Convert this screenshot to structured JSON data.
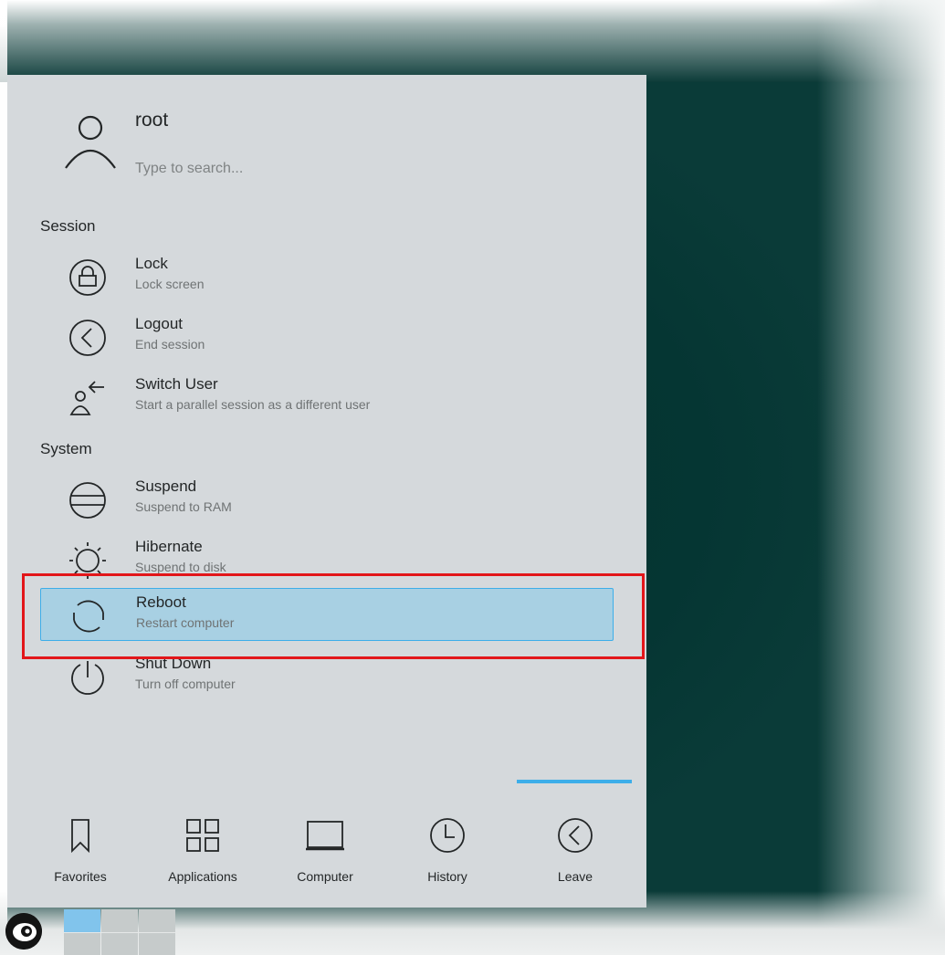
{
  "user": {
    "name": "root",
    "search_placeholder": "Type to search..."
  },
  "sections": {
    "session": "Session",
    "system": "System"
  },
  "session_items": [
    {
      "label": "Lock",
      "description": "Lock screen",
      "icon": "lock-icon"
    },
    {
      "label": "Logout",
      "description": "End session",
      "icon": "logout-icon"
    },
    {
      "label": "Switch User",
      "description": "Start a parallel session as a different user",
      "icon": "switch-user-icon"
    }
  ],
  "system_items": [
    {
      "label": "Suspend",
      "description": "Suspend to RAM",
      "icon": "suspend-icon"
    },
    {
      "label": "Hibernate",
      "description": "Suspend to disk",
      "icon": "hibernate-icon"
    },
    {
      "label": "Reboot",
      "description": "Restart computer",
      "icon": "reboot-icon",
      "selected": true
    },
    {
      "label": "Shut Down",
      "description": "Turn off computer",
      "icon": "power-icon"
    }
  ],
  "tabs": [
    {
      "label": "Favorites",
      "icon": "bookmark-icon"
    },
    {
      "label": "Applications",
      "icon": "grid-icon"
    },
    {
      "label": "Computer",
      "icon": "laptop-icon"
    },
    {
      "label": "History",
      "icon": "clock-icon"
    },
    {
      "label": "Leave",
      "icon": "leave-icon",
      "active": true
    }
  ],
  "colors": {
    "menu_bg": "#d5d9dc",
    "selection_bg": "#a8d0e3",
    "accent": "#3daee9",
    "highlight_border": "#e2161a",
    "wallpaper": "#053633"
  }
}
